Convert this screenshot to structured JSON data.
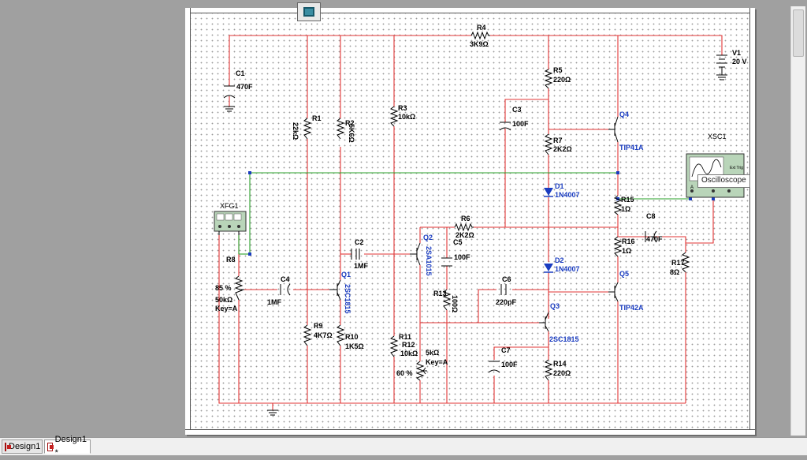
{
  "tabs": [
    {
      "label": "Design1",
      "active": false
    },
    {
      "label": "Design1 *",
      "active": true
    }
  ],
  "tooltip": "Oscilloscope",
  "components": {
    "R4": {
      "ref": "R4",
      "value": "3K9Ω"
    },
    "V1": {
      "ref": "V1",
      "value": "20 V"
    },
    "C1": {
      "ref": "C1",
      "value": "470F"
    },
    "R5": {
      "ref": "R5",
      "value": "220Ω"
    },
    "C3": {
      "ref": "C3",
      "value": "100F"
    },
    "R1": {
      "ref": "R1",
      "value": "22kΩ"
    },
    "R2": {
      "ref": "R2",
      "value": "5K6Ω"
    },
    "R3": {
      "ref": "R3",
      "value": "10kΩ"
    },
    "Q4": {
      "ref": "Q4",
      "value": "TIP41A"
    },
    "R7": {
      "ref": "R7",
      "value": "2K2Ω"
    },
    "XSC1": {
      "ref": "XSC1",
      "ext": "Ext Trig",
      "a": "A"
    },
    "D1": {
      "ref": "D1",
      "value": "1N4007"
    },
    "XFG1": {
      "ref": "XFG1"
    },
    "R15": {
      "ref": "R15",
      "value": "1Ω"
    },
    "R6": {
      "ref": "R6",
      "value": "2K2Ω"
    },
    "C8": {
      "ref": "C8",
      "value": "470F"
    },
    "C2": {
      "ref": "C2",
      "value": "1MF"
    },
    "Q2": {
      "ref": "Q2",
      "value": "2SA1015"
    },
    "C5": {
      "ref": "C5",
      "value": "100F"
    },
    "R16": {
      "ref": "R16",
      "value": "1Ω"
    },
    "R8": {
      "ref": "R8",
      "percent": "85 %",
      "value": "50kΩ",
      "key": "Key=A"
    },
    "R17": {
      "ref": "R17",
      "value": "8Ω"
    },
    "D2": {
      "ref": "D2",
      "value": "1N4007"
    },
    "Q1": {
      "ref": "Q1",
      "value": "2SC1815"
    },
    "C4": {
      "ref": "C4",
      "value": "1MF"
    },
    "C6": {
      "ref": "C6",
      "value": "220pF"
    },
    "Q5": {
      "ref": "Q5",
      "value": "TIP42A"
    },
    "R13": {
      "ref": "R13",
      "value": "100Ω"
    },
    "Q3": {
      "ref": "Q3",
      "value": "2SC1815"
    },
    "R9": {
      "ref": "R9",
      "value": "4K7Ω"
    },
    "R10": {
      "ref": "R10",
      "value": "1K5Ω"
    },
    "R11": {
      "ref": "R11"
    },
    "R12": {
      "ref": "R12",
      "value": "10kΩ",
      "pot_value": "5kΩ",
      "key": "Key=A",
      "percent": "60 %"
    },
    "C7": {
      "ref": "C7",
      "value": "100F"
    },
    "R14": {
      "ref": "R14",
      "value": "220Ω"
    }
  },
  "colors": {
    "wire": "#e23434",
    "signal_wire": "#2aa02a",
    "component_label": "#1a3cc0",
    "background": "#a0a0a0"
  }
}
